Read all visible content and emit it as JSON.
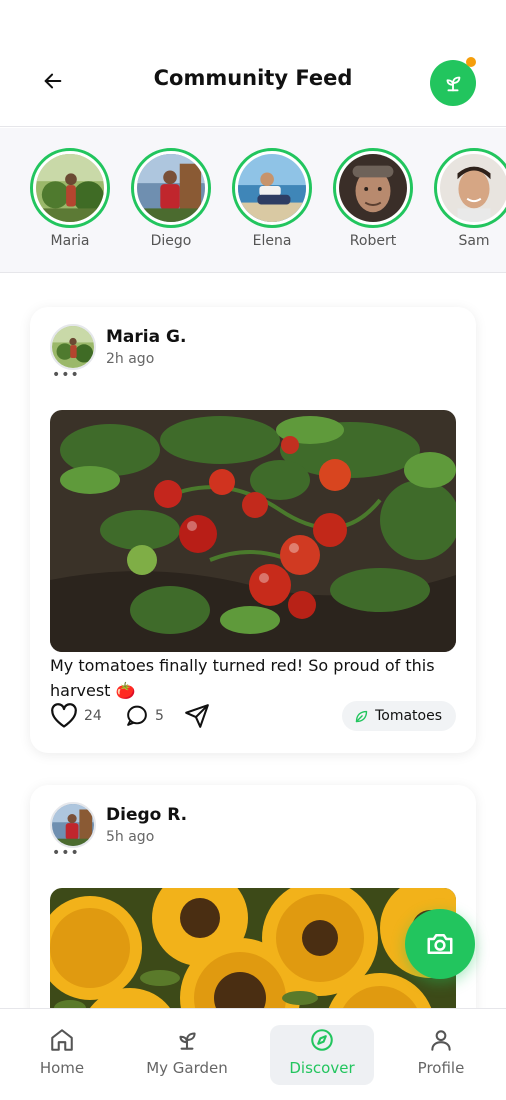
{
  "header": {
    "title": "Community Feed",
    "back_icon": "arrow-left-icon",
    "profile_icon": "sprout-icon",
    "accent": "#22c55e",
    "notification_dot_color": "#f59e0b"
  },
  "stories": [
    {
      "name": "Maria",
      "avatar": "woman-garden-photo"
    },
    {
      "name": "Diego",
      "avatar": "man-red-shirt-photo"
    },
    {
      "name": "Elena",
      "avatar": "woman-beach-photo"
    },
    {
      "name": "Robert",
      "avatar": "elderly-man-photo"
    },
    {
      "name": "Sam",
      "avatar": "young-man-photo"
    }
  ],
  "posts": [
    {
      "author": "Maria G.",
      "time": "2h ago",
      "more": "•••",
      "image": "tomato-plant-photo",
      "caption": "My tomatoes finally turned red! So proud of this harvest 🍅",
      "likes": "24",
      "comments": "5",
      "tag": "Tomatoes"
    },
    {
      "author": "Diego R.",
      "time": "5h ago",
      "more": "•••",
      "image": "sunflowers-photo"
    }
  ],
  "fab": {
    "icon": "camera-icon"
  },
  "nav": [
    {
      "label": "Home",
      "icon": "home-icon",
      "active": false
    },
    {
      "label": "My Garden",
      "icon": "sprout-icon",
      "active": false
    },
    {
      "label": "Discover",
      "icon": "compass-icon",
      "active": true
    },
    {
      "label": "Profile",
      "icon": "user-icon",
      "active": false
    }
  ]
}
